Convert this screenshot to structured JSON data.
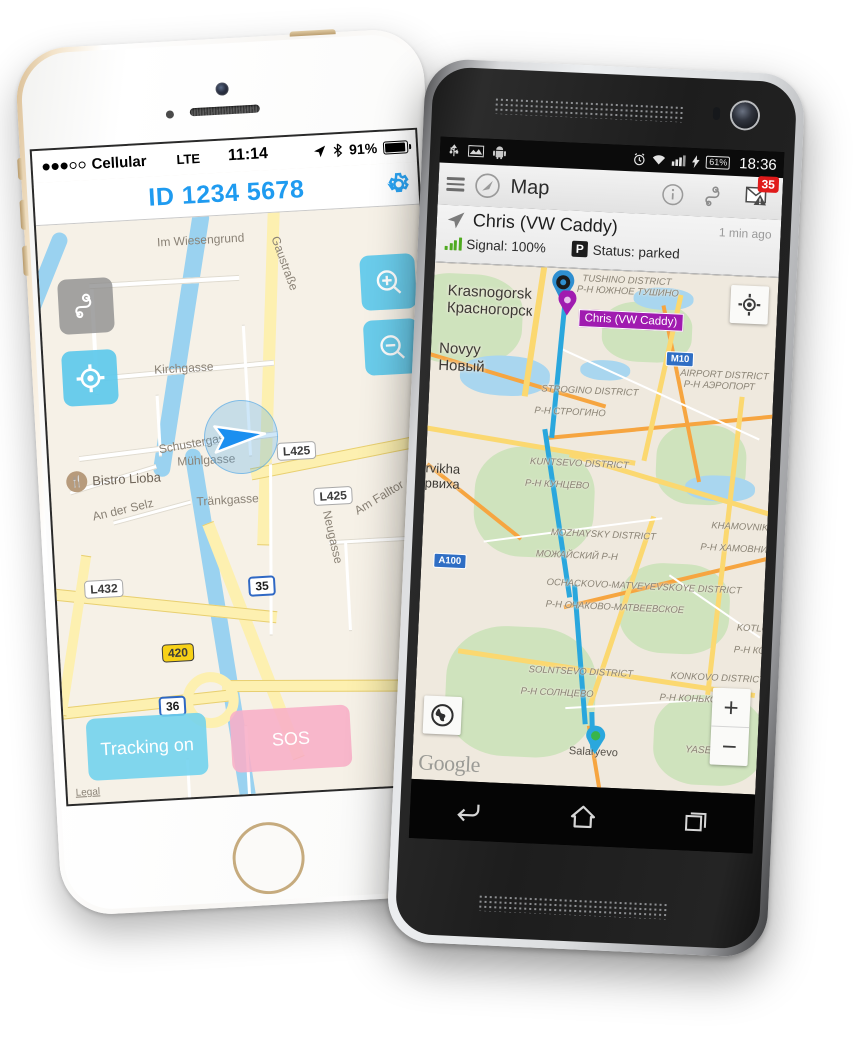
{
  "iphone": {
    "status_bar": {
      "signal_dots_filled": 3,
      "signal_dots_empty": 2,
      "carrier": "Cellular",
      "network": "LTE",
      "time": "11:14",
      "battery_percent": "91%",
      "icons": [
        "location-arrow-icon",
        "bluetooth-icon",
        "battery-icon"
      ]
    },
    "nav_bar": {
      "title": "ID 1234 5678",
      "title_color": "#1f9bf0",
      "settings_icon": "gear-icon"
    },
    "map": {
      "street_labels": [
        "Im Wiesengrund",
        "Gaustraße",
        "Kirchgasse",
        "Schustergasse",
        "Am Falltor",
        "Mühlgasse",
        "An der Selz",
        "Tränkgasse",
        "Neugasse"
      ],
      "shields": [
        "L425",
        "L425",
        "L432",
        "35",
        "420",
        "36"
      ],
      "poi": {
        "name": "Bistro Lioba",
        "icon": "restaurant-icon"
      },
      "controls": [
        {
          "name": "route-button",
          "icon": "route-icon",
          "color": "#8c8c8c"
        },
        {
          "name": "locate-button",
          "icon": "crosshair-icon",
          "color": "#5dc9ec"
        },
        {
          "name": "zoom-in-button",
          "icon": "zoom-in-icon",
          "color": "#5dc9ec"
        },
        {
          "name": "zoom-out-button",
          "icon": "zoom-out-icon",
          "color": "#5dc9ec"
        }
      ],
      "legal_link": "Legal"
    },
    "buttons": {
      "tracking": {
        "label": "Tracking on",
        "color": "#6fd2ee"
      },
      "sos": {
        "label": "SOS",
        "color": "#f8aec7"
      }
    }
  },
  "android": {
    "status_bar": {
      "left_icons": [
        "usb-icon",
        "screenshot-icon",
        "android-icon"
      ],
      "right_icons": [
        "alarm-icon",
        "wifi-icon",
        "signal-icon",
        "charging-icon"
      ],
      "battery_percent": "61%",
      "time": "18:36"
    },
    "action_bar": {
      "menu_icon": "hamburger-menu-icon",
      "app_icon": "compass-icon",
      "title": "Map",
      "actions": [
        {
          "name": "info-button",
          "icon": "info-icon"
        },
        {
          "name": "track-button",
          "icon": "route-icon"
        },
        {
          "name": "messages-button",
          "icon": "mail-warning-icon",
          "badge": "35",
          "badge_color": "#e01b1b"
        }
      ]
    },
    "info_panel": {
      "device_icon": "navigation-arrow-icon",
      "device_name": "Chris (VW Caddy)",
      "timestamp": "1 min ago",
      "signal_icon": "signal-bars-icon",
      "signal_label": "Signal: 100%",
      "status_icon": "parking-icon",
      "status_label": "Status: parked"
    },
    "map": {
      "marker_label": "Chris (VW Caddy)",
      "marker_color": "#a01bb0",
      "cities": [
        {
          "name": "Krasnogorsk",
          "name_ru": "Красногорск"
        },
        {
          "name": "Novyy",
          "name_ru": "Новый"
        },
        {
          "name": "Barvikha",
          "name_ru": "Барвиха"
        }
      ],
      "districts": [
        {
          "en": "TUSHINO DISTRICT",
          "ru": "Р-Н ЮЖНОЕ ТУШИНО"
        },
        {
          "en": "STROGINO DISTRICT",
          "ru": "Р-Н СТРОГИНО"
        },
        {
          "en": "AIRPORT DISTRICT",
          "ru": "Р-Н АЭРОПОРТ"
        },
        {
          "en": "KUNTSEVO DISTRICT",
          "ru": "Р-Н КУНЦЕВО"
        },
        {
          "en": "MOZHAYSKY DISTRICT",
          "ru": "МОЖАЙСКИЙ Р-Н"
        },
        {
          "en": "KHAMOVNIKI DISTRICT",
          "ru": "Р-Н ХАМОВНИКИ"
        },
        {
          "en": "OCHACKOVO-MATVEYEVSKOYE DISTRICT",
          "ru": "Р-Н ОЧАКОВО-МАТВЕЕВСКОЕ"
        },
        {
          "en": "SOLNTSEVO DISTRICT",
          "ru": "Р-Н СОЛНЦЕВО"
        },
        {
          "en": "KONKOVO DISTRICT",
          "ru": "Р-Н КОНЬКОВО"
        },
        {
          "en": "KOTLOVKA DISTRICT",
          "ru": "Р-Н КОТЛОВКА"
        }
      ],
      "towns": [
        "Salaryevo",
        "YASENEVO"
      ],
      "shields": [
        "M10",
        "A100"
      ],
      "attribution": "Google",
      "controls": [
        {
          "name": "my-location-button",
          "icon": "my-location-icon"
        },
        {
          "name": "map-layers-button",
          "icon": "globe-icon"
        },
        {
          "name": "zoom-in-button",
          "label": "+"
        },
        {
          "name": "zoom-out-button",
          "label": "−"
        }
      ]
    },
    "nav_bar": {
      "buttons": [
        {
          "name": "back-button",
          "icon": "back-arrow-icon"
        },
        {
          "name": "home-button",
          "icon": "home-icon"
        },
        {
          "name": "recents-button",
          "icon": "recents-icon"
        }
      ]
    }
  }
}
